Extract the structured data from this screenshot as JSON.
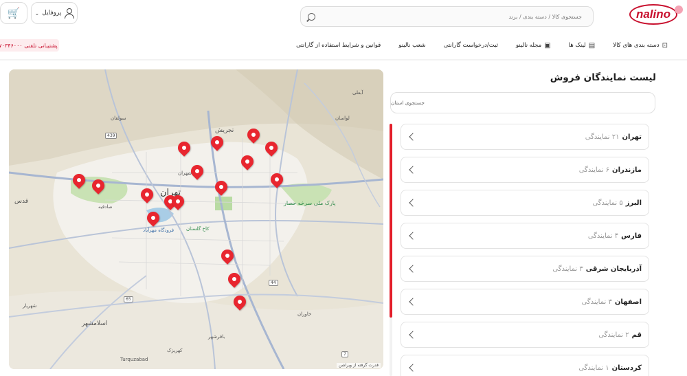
{
  "header": {
    "logo_text": "nalino",
    "search_placeholder": "جستجوی کالا / دسته بندی / برند",
    "profile_label": "پروفایل",
    "support_label": "پشتیبانی تلفنی ۷۰۳۴۶۰۰۰"
  },
  "nav": {
    "items": [
      {
        "label": "دسته بندی های کالا",
        "icon": "gift-icon"
      },
      {
        "label": "لینک ها",
        "icon": "grid-icon"
      },
      {
        "label": "مجله نالینو",
        "icon": "newspaper-icon"
      },
      {
        "label": "ثبت/درخواست گارانتی",
        "icon": ""
      },
      {
        "label": "شعب نالینو",
        "icon": ""
      },
      {
        "label": "قوانین و شرایط استفاده از گارانتی",
        "icon": ""
      }
    ]
  },
  "sidebar": {
    "title": "لیست نمایندگان فروش",
    "province_search_placeholder": "جستجوی استان",
    "provinces": [
      {
        "name": "تهران",
        "count": "۲۱ نمایندگی"
      },
      {
        "name": "مازندران",
        "count": "۶ نمایندگی"
      },
      {
        "name": "البرز",
        "count": "۵ نمایندگی"
      },
      {
        "name": "فارس",
        "count": "۴ نمایندگی"
      },
      {
        "name": "آذربایجان شرقی",
        "count": "۳ نمایندگی"
      },
      {
        "name": "اصفهان",
        "count": "۳ نمایندگی"
      },
      {
        "name": "قم",
        "count": "۲ نمایندگی"
      },
      {
        "name": "کردستان",
        "count": "۱ نمایندگی"
      }
    ]
  },
  "map": {
    "attribution": "قدرت گرفته از ویراشن",
    "labels": {
      "tehran": "تهران",
      "tajrish": "تجریش",
      "qods": "قدس",
      "eslamshahr": "اسلامشهر",
      "shahran": "شهران",
      "lavasan": "لواسان",
      "solaghan": "سولقان",
      "ab_ali": "آبعلی",
      "golestan": "کاخ گلستان",
      "mehrabad": "فرودگاه مهرآباد",
      "sorkheh_hesar": "پارک ملی سرخه حصار",
      "sadeghieh": "صادقیه",
      "shahriar": "شهریار",
      "pakdasht": "خاوران",
      "turqozabad": "Turquzabad",
      "baqershahr": "باقرشهر",
      "kahrizak": "کهریزک",
      "road_439": "439",
      "road_65": "65",
      "road_44": "44",
      "road_7": "7"
    }
  }
}
